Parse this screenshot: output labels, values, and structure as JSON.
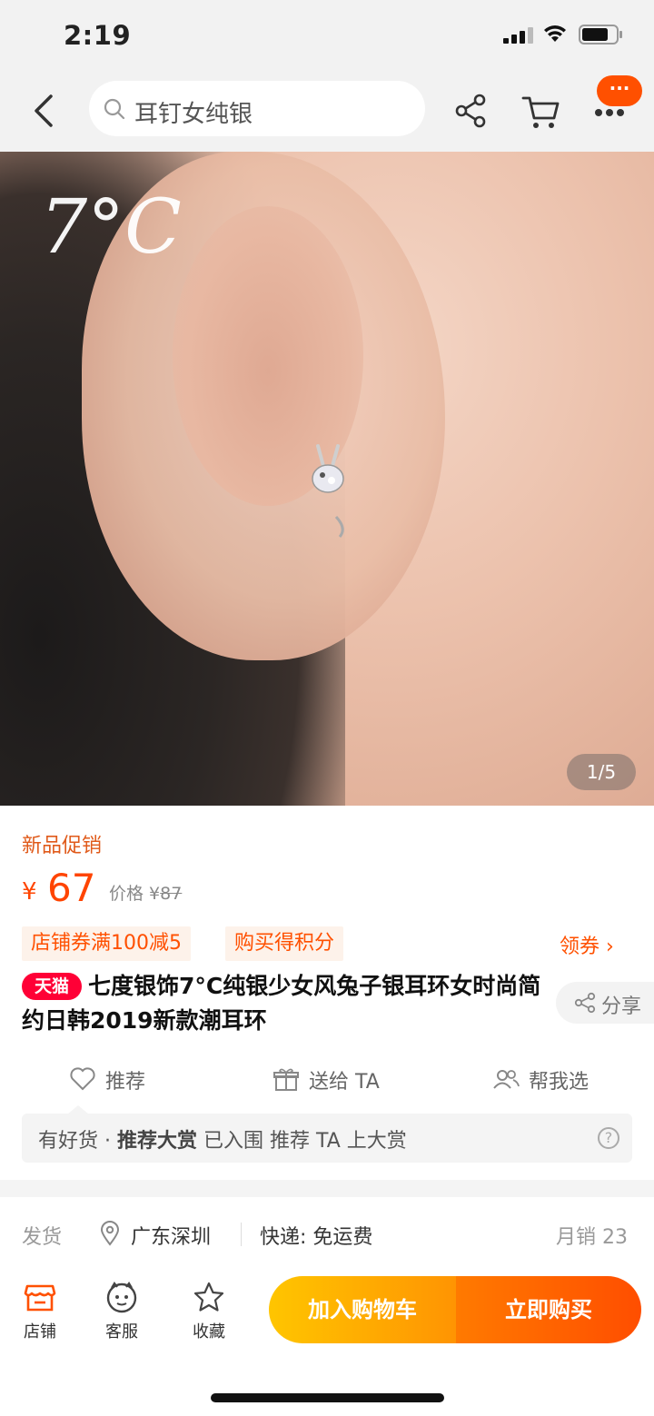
{
  "status_bar": {
    "time": "2:19"
  },
  "nav": {
    "search_placeholder": "耳钉女纯银",
    "badge": "···"
  },
  "hero": {
    "brand_logo": "7°C",
    "page_indicator": "1/5"
  },
  "product": {
    "promo_tag": "新品促销",
    "currency": "¥",
    "price": "67",
    "orig_price_label": "价格 ¥",
    "orig_price": "87",
    "coupons": [
      "店铺券满100减5",
      "购买得积分"
    ],
    "claim_label": "领券 ›",
    "tmall_badge": "天猫",
    "title": "七度银饰7°C纯银少女风兔子银耳环女时尚简约日韩2019新款潮耳环",
    "share_label": "分享"
  },
  "actions": {
    "recommend": "推荐",
    "gift": "送给 TA",
    "help_choose": "帮我选"
  },
  "award": {
    "prefix": "有好货 · ",
    "highlight": "推荐大赏",
    "suffix": " 已入围 推荐 TA 上大赏",
    "help": "?"
  },
  "shipping": {
    "label": "发货",
    "location": "广东深圳",
    "express": "快递: 免运费",
    "monthly_sales": "月销 23"
  },
  "bottom_bar": {
    "shop": "店铺",
    "service": "客服",
    "favorite": "收藏",
    "add_to_cart": "加入购物车",
    "buy_now": "立即购买"
  },
  "colors": {
    "accent": "#ff5000",
    "price": "#ff4400",
    "tmall": "#ff0036",
    "cart_gradient": [
      "#ffc500",
      "#ff9402"
    ],
    "buy_gradient": [
      "#ff7a00",
      "#ff4e00"
    ]
  }
}
